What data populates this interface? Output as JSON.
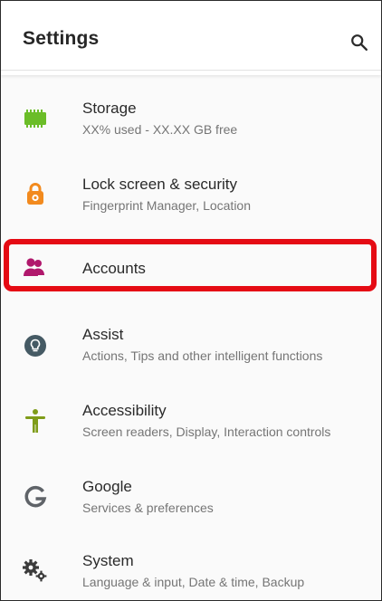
{
  "header": {
    "title": "Settings",
    "search_icon": "search-icon"
  },
  "settings": [
    {
      "name": "storage",
      "icon": "storage-icon",
      "title": "Storage",
      "subtitle": "XX% used - XX.XX GB free"
    },
    {
      "name": "lock-screen-security",
      "icon": "lock-icon",
      "title": "Lock screen & security",
      "subtitle": "Fingerprint Manager, Location"
    },
    {
      "name": "accounts",
      "icon": "accounts-icon",
      "title": "Accounts",
      "subtitle": ""
    },
    {
      "name": "assist",
      "icon": "lightbulb-icon",
      "title": "Assist",
      "subtitle": "Actions, Tips and other intelligent functions"
    },
    {
      "name": "accessibility",
      "icon": "accessibility-icon",
      "title": "Accessibility",
      "subtitle": "Screen readers, Display, Interaction controls"
    },
    {
      "name": "google",
      "icon": "google-icon",
      "title": "Google",
      "subtitle": "Services & preferences"
    },
    {
      "name": "system",
      "icon": "gears-icon",
      "title": "System",
      "subtitle": "Language & input, Date & time, Backup"
    }
  ],
  "colors": {
    "storage": "#6bbd28",
    "lock": "#f28a1e",
    "accounts": "#b0186c",
    "assist": "#455a64",
    "accessibility": "#7f9c19",
    "google": "#5f6368",
    "system": "#3b3b3b",
    "highlight": "#e50b14"
  }
}
